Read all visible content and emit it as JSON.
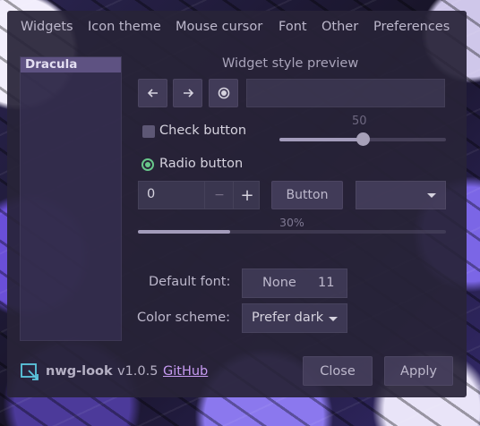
{
  "tabs": [
    "Widgets",
    "Icon theme",
    "Mouse cursor",
    "Font",
    "Other",
    "Preferences"
  ],
  "themes": [
    "Dracula"
  ],
  "preview": {
    "title": "Widget style preview",
    "check_label": "Check button",
    "radio_label": "Radio button",
    "slider_value": "50",
    "slider_fraction": 0.5,
    "spin_value": "0",
    "spin_minus": "−",
    "spin_plus": "+",
    "button_label": "Button",
    "progress_text": "30%",
    "progress_fraction": 0.3
  },
  "settings": {
    "default_font_label": "Default font:",
    "font_name": "None",
    "font_size": "11",
    "color_scheme_label": "Color scheme:",
    "color_scheme_value": "Prefer dark"
  },
  "footer": {
    "app_name": "nwg-look",
    "version": "v1.0.5",
    "link": "GitHub",
    "close_label": "Close",
    "apply_label": "Apply"
  },
  "colors": {
    "accent": "#68c68a",
    "link": "#c79bf2",
    "selected_item": "#5e5282"
  }
}
